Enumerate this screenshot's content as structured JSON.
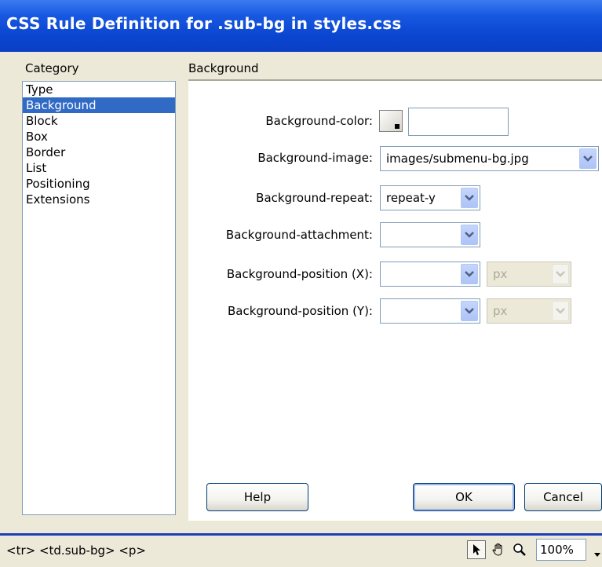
{
  "window": {
    "title": "CSS Rule Definition for .sub-bg in styles.css"
  },
  "category": {
    "heading": "Category",
    "items": [
      "Type",
      "Background",
      "Block",
      "Box",
      "Border",
      "List",
      "Positioning",
      "Extensions"
    ],
    "selected": "Background"
  },
  "background": {
    "heading": "Background",
    "color_label": "Background-color:",
    "color_value": "",
    "image_label": "Background-image:",
    "image_value": "images/submenu-bg.jpg",
    "repeat_label": "Background-repeat:",
    "repeat_value": "repeat-y",
    "attachment_label": "Background-attachment:",
    "attachment_value": "",
    "pos_x_label": "Background-position (X):",
    "pos_x_value": "",
    "pos_x_unit": "px",
    "pos_y_label": "Background-position (Y):",
    "pos_y_value": "",
    "pos_y_unit": "px"
  },
  "buttons": {
    "help": "Help",
    "ok": "OK",
    "cancel": "Cancel"
  },
  "statusbar": {
    "tag_path": "<tr> <td.sub-bg> <p>",
    "zoom": "100%"
  },
  "colors": {
    "titlebar": "#0a45d0",
    "selection": "#316ac5",
    "panel": "#ffffff",
    "dialog_bg": "#ece9d8"
  }
}
